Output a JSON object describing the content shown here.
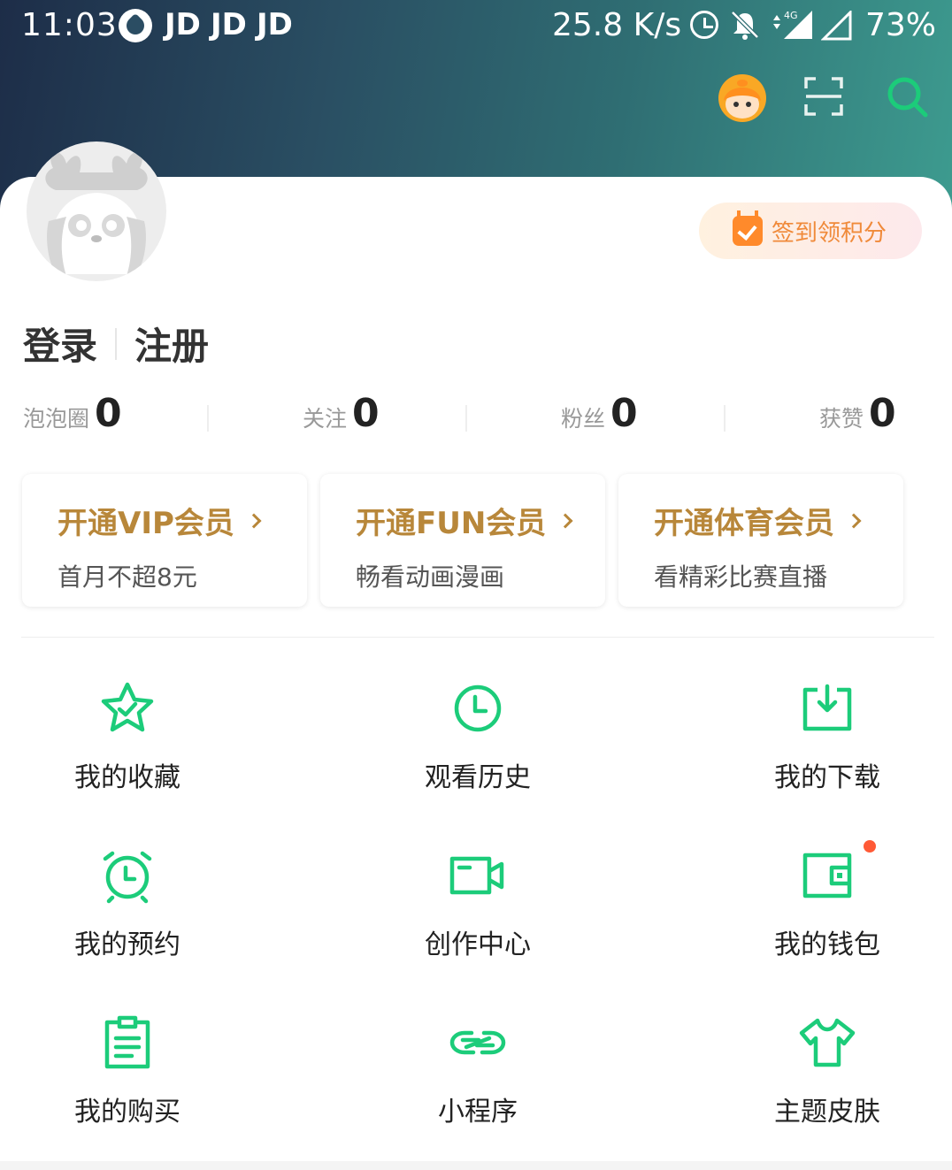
{
  "status_bar": {
    "time": "11:03",
    "notif_jd": [
      "JD",
      "JD",
      "JD"
    ],
    "net_speed": "25.8 K/s",
    "network": "4G",
    "battery": "73%"
  },
  "header": {
    "icons": [
      "mascot-icon",
      "scan-icon",
      "search-icon"
    ]
  },
  "checkin": {
    "label": "签到领积分"
  },
  "auth": {
    "login": "登录",
    "register": "注册"
  },
  "stats": [
    {
      "label": "泡泡圈",
      "value": "0"
    },
    {
      "label": "关注",
      "value": "0"
    },
    {
      "label": "粉丝",
      "value": "0"
    },
    {
      "label": "获赞",
      "value": "0"
    }
  ],
  "memberships": [
    {
      "title": "开通VIP会员",
      "subtitle": "首月不超8元"
    },
    {
      "title": "开通FUN会员",
      "subtitle": "畅看动画漫画"
    },
    {
      "title": "开通体育会员",
      "subtitle": "看精彩比赛直播"
    }
  ],
  "menu": [
    {
      "label": "我的收藏",
      "icon": "star-icon"
    },
    {
      "label": "观看历史",
      "icon": "clock-icon"
    },
    {
      "label": "我的下载",
      "icon": "download-icon"
    },
    {
      "label": "我的预约",
      "icon": "alarm-clock-icon"
    },
    {
      "label": "创作中心",
      "icon": "video-camera-icon"
    },
    {
      "label": "我的钱包",
      "icon": "wallet-icon"
    },
    {
      "label": "我的购买",
      "icon": "clipboard-icon"
    },
    {
      "label": "小程序",
      "icon": "link-icon"
    },
    {
      "label": "主题皮肤",
      "icon": "tshirt-icon"
    }
  ],
  "colors": {
    "accent_green": "#1ccc7a",
    "gold": "#b8873a",
    "checkin_orange": "#f08a3a",
    "badge_red": "#ff5a36"
  }
}
